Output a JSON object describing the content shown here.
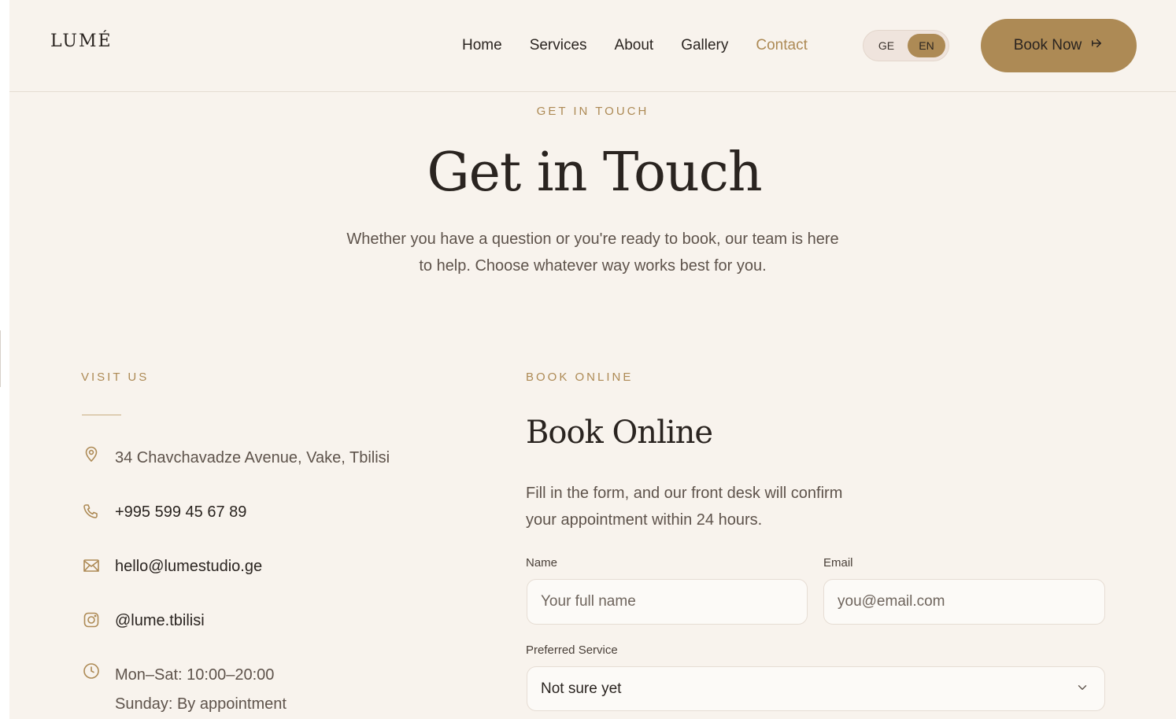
{
  "brand": {
    "logo": "LUMÉ"
  },
  "nav": {
    "items": [
      {
        "label": "Home"
      },
      {
        "label": "Services"
      },
      {
        "label": "About"
      },
      {
        "label": "Gallery"
      },
      {
        "label": "Contact",
        "active": true
      }
    ]
  },
  "language": {
    "options": [
      "GE",
      "EN"
    ],
    "selected": "EN"
  },
  "header": {
    "cta_label": "Book Now"
  },
  "hero": {
    "eyebrow": "GET IN TOUCH",
    "title": "Get in Touch",
    "subtitle": "Whether you have a question or you're ready to book, our team is here to help. Choose whatever way works best for you."
  },
  "visit": {
    "eyebrow": "VISIT US",
    "address": "34 Chavchavadze Avenue, Vake, Tbilisi",
    "phone": "+995 599 45 67 89",
    "email": "hello@lumestudio.ge",
    "instagram": "@lume.tbilisi",
    "hours_weekday": "Mon–Sat: 10:00–20:00",
    "hours_sunday": "Sunday: By appointment"
  },
  "booking": {
    "eyebrow": "BOOK ONLINE",
    "title": "Book Online",
    "description": "Fill in the form, and our front desk will confirm your appointment within 24 hours.",
    "name_label": "Name",
    "name_placeholder": "Your full name",
    "email_label": "Email",
    "email_placeholder": "you@email.com",
    "service_label": "Preferred Service",
    "service_selected": "Not sure yet"
  },
  "colors": {
    "background": "#f8f3ed",
    "accent": "#ad8a55",
    "text": "#2a2420",
    "muted_text": "#5e534b"
  },
  "icons": {
    "address": "map-pin-icon",
    "phone": "phone-icon",
    "email": "mail-icon",
    "instagram": "instagram-icon",
    "hours": "clock-icon",
    "cta": "arrow-right-icon",
    "select": "chevron-down-icon"
  }
}
